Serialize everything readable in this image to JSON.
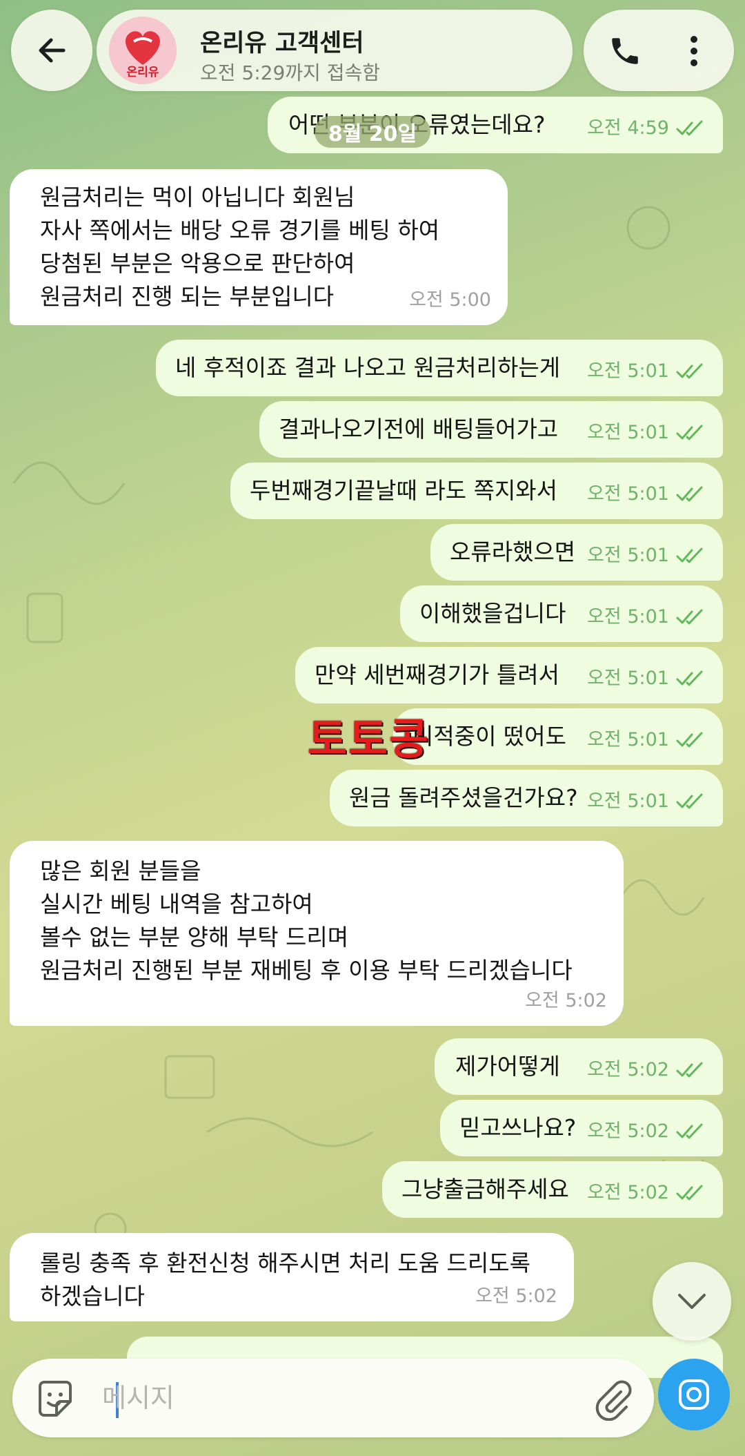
{
  "header": {
    "title": "온리유 고객센터",
    "status": "오전 5:29까지 접속함",
    "avatar_text": "온리유"
  },
  "date_label": "8월 20일",
  "watermark": "토토콩",
  "messages": [
    {
      "dir": "out",
      "text": "어떤 부분이 오류였는데요?",
      "time": "오전 4:59"
    },
    {
      "dir": "in",
      "text": "원금처리는 먹이 아닙니다 회원님\n자사 쪽에서는 배당 오류 경기를 베팅 하여\n당첨된 부분은 악용으로 판단하여\n원금처리 진행 되는 부분입니다",
      "time": "오전 5:00"
    },
    {
      "dir": "out",
      "text": "네 후적이죠 결과 나오고 원금처리하는게",
      "time": "오전 5:01"
    },
    {
      "dir": "out",
      "text": "결과나오기전에 배팅들어가고",
      "time": "오전 5:01"
    },
    {
      "dir": "out",
      "text": "두번째경기끝날때 라도 쪽지와서",
      "time": "오전 5:01"
    },
    {
      "dir": "out",
      "text": "오류라했으면",
      "time": "오전 5:01"
    },
    {
      "dir": "out",
      "text": "이해했을겁니다",
      "time": "오전 5:01"
    },
    {
      "dir": "out",
      "text": "만약 세번째경기가 틀려서",
      "time": "오전 5:01"
    },
    {
      "dir": "out",
      "text": "미적중이 떴어도",
      "time": "오전 5:01"
    },
    {
      "dir": "out",
      "text": "원금 돌려주셨을건가요?",
      "time": "오전 5:01"
    },
    {
      "dir": "in",
      "text": "많은 회원 분들을\n실시간 베팅 내역을 참고하여\n볼수 없는 부분 양해 부탁 드리며\n원금처리 진행된 부분 재베팅 후 이용 부탁 드리겠습니다",
      "time": "오전 5:02"
    },
    {
      "dir": "out",
      "text": "제가어떻게",
      "time": "오전 5:02"
    },
    {
      "dir": "out",
      "text": "믿고쓰나요?",
      "time": "오전 5:02"
    },
    {
      "dir": "out",
      "text": "그냥출금해주세요",
      "time": "오전 5:02"
    },
    {
      "dir": "in",
      "text": "롤링 충족 후 환전신청 해주시면 처리 도움 드리도록\n하겠습니다",
      "time": "오전 5:02"
    }
  ],
  "input": {
    "placeholder": "메시지"
  }
}
